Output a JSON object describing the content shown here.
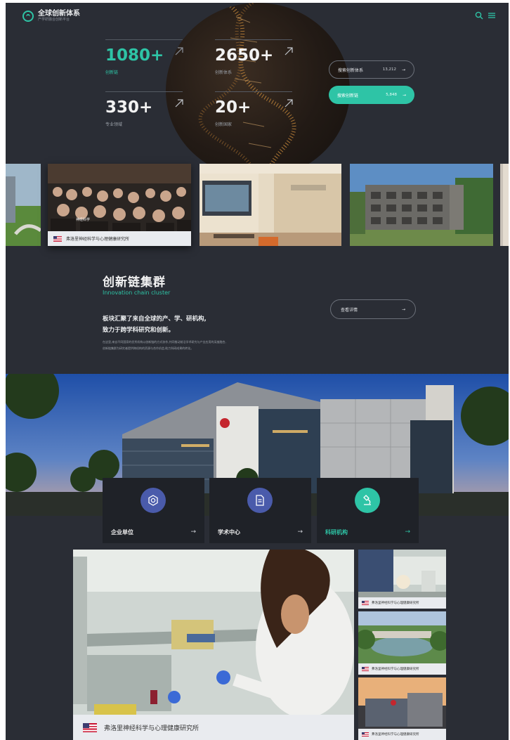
{
  "header": {
    "logo_title": "全球创新体系",
    "logo_subtitle": "产学研融合创新平台"
  },
  "stats": [
    {
      "value": "1080+",
      "label": "创新链"
    },
    {
      "value": "2650+",
      "label": "创新体系"
    },
    {
      "value": "330+",
      "label": "专业领域"
    },
    {
      "value": "20+",
      "label": "创新国家"
    }
  ],
  "actions": {
    "search_system": {
      "label": "搜索创新体系",
      "count": "13,212"
    },
    "search_chain": {
      "label": "搜索创新链",
      "count": "5,848"
    }
  },
  "carousel": {
    "active_caption": "弗洛里神经科学与心理健康研究所",
    "active_tag": "神经科学"
  },
  "cluster": {
    "title": "创新链集群",
    "subtitle": "Innovation chain cluster",
    "desc_line1": "板块汇聚了来自全球的产、学、研机构,",
    "desc_line2": "致力于跨学科研究和创新。",
    "small_line1": "在这里,来自不同国家的优秀机构以创新链的方式协作,共同推动前沿学术研究与产业应用的深度融合,",
    "small_line2": "创新链集群为研究者提供跨机构的资源与合作机会,助力科研成果的转化。",
    "detail_button": "查看详情"
  },
  "categories": [
    {
      "label": "企业单位",
      "icon": "enterprise-icon",
      "color": "#4a5bab"
    },
    {
      "label": "学术中心",
      "icon": "document-icon",
      "color": "#4a5bab"
    },
    {
      "label": "科研机构",
      "icon": "microscope-icon",
      "color": "#2ec4a6"
    }
  ],
  "featured": {
    "caption": "弗洛里神经科学与心理健康研究所"
  },
  "side_list": [
    {
      "caption": "弗洛里神经科学与心理健康研究所"
    },
    {
      "caption": "弗洛里神经科学与心理健康研究所"
    },
    {
      "caption": "弗洛里神经科学与心理健康研究所"
    }
  ],
  "colors": {
    "accent": "#2ec4a6",
    "background": "#2a2d35",
    "tile_bg": "#1f2228",
    "icon_blue": "#4a5bab"
  }
}
